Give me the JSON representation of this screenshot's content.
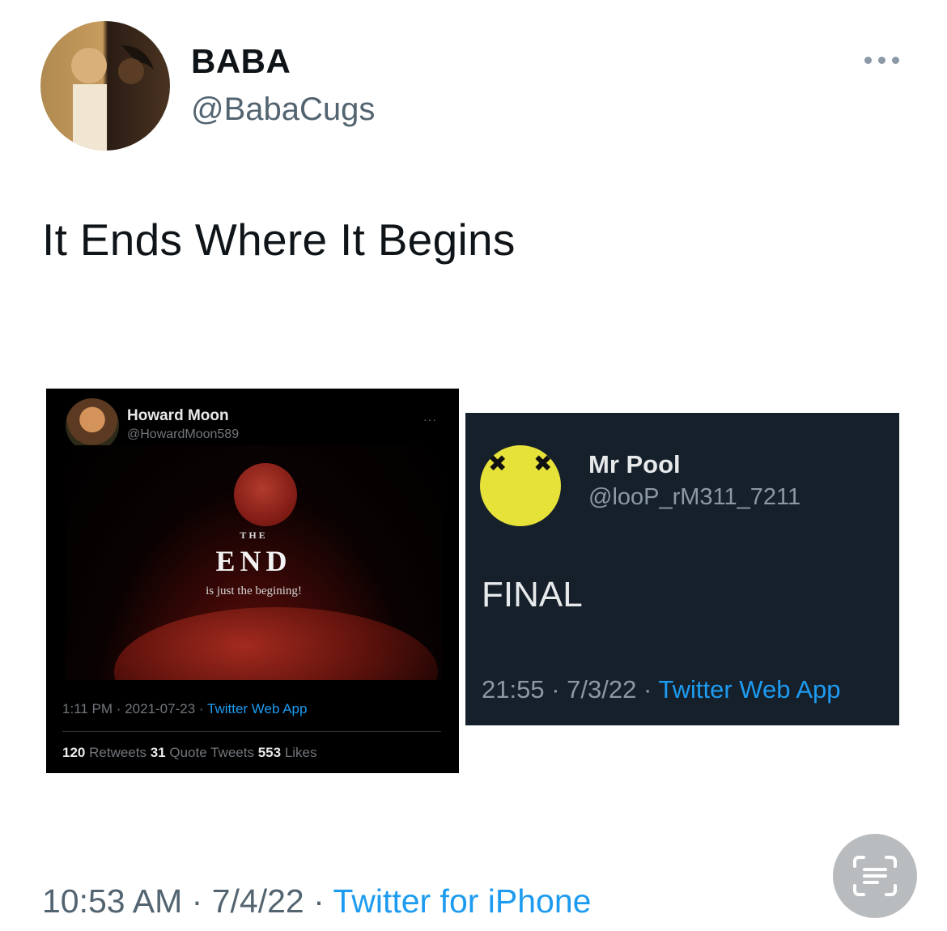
{
  "tweet": {
    "display_name": "BABA",
    "handle": "@BabaCugs",
    "text": "It Ends Where It Begins",
    "time": "10:53 AM",
    "date": "7/4/22",
    "source": "Twitter for iPhone",
    "separator": "·"
  },
  "embedded_left": {
    "display_name": "Howard Moon",
    "handle": "@HowardMoon589",
    "more": "···",
    "image_text": {
      "the": "THE",
      "end": "END",
      "sub": "is just the begining!"
    },
    "time": "1:11 PM",
    "date": "2021-07-23",
    "source": "Twitter Web App",
    "retweets": "120",
    "retweets_label": "Retweets",
    "quotes": "31",
    "quotes_label": "Quote Tweets",
    "likes": "553",
    "likes_label": "Likes"
  },
  "embedded_right": {
    "display_name": "Mr Pool",
    "handle": "@looP_rM311_7211",
    "text": "FINAL",
    "time": "21:55",
    "date": "7/3/22",
    "source": "Twitter Web App"
  },
  "icons": {
    "more": "more-horizontal-icon",
    "scan": "live-text-scan-icon"
  },
  "colors": {
    "link": "#1d9bf0",
    "secondary_text": "#536471",
    "dim_bg": "#15202b"
  }
}
